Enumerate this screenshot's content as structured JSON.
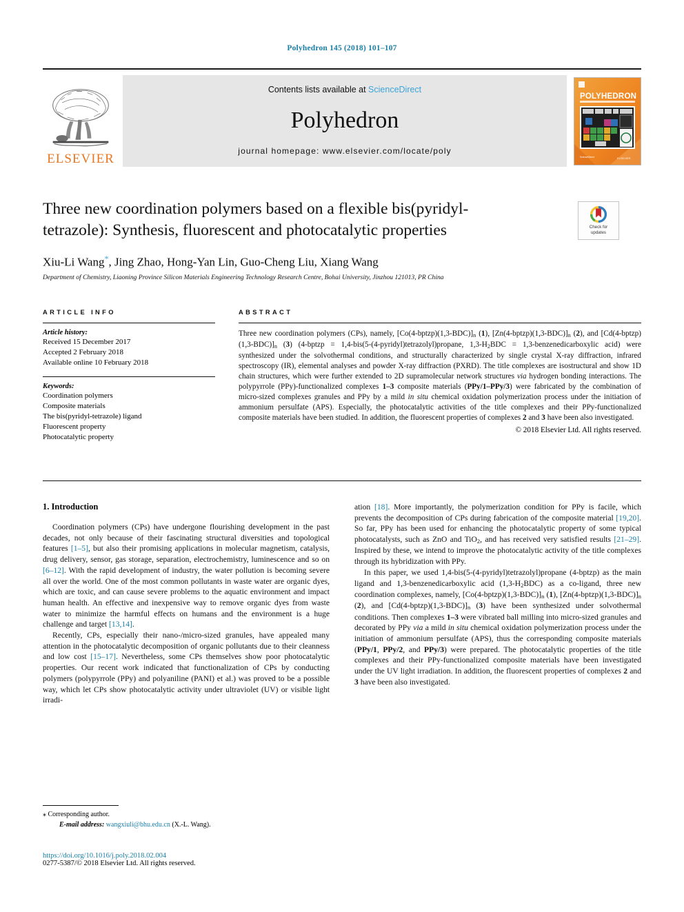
{
  "running_head": "Polyhedron 145 (2018) 101–107",
  "masthead": {
    "publisher_name": "ELSEVIER",
    "contents_prefix": "Contents lists available at ",
    "contents_link": "ScienceDirect",
    "journal_name": "Polyhedron",
    "homepage": "journal homepage: www.elsevier.com/locate/poly",
    "cover_title": "POLYHEDRON",
    "cover_subtitle": "THE INTERNATIONAL JOURNAL FOR INORGANIC AND ORGANOMETALLIC CHEMISTRY",
    "cover_publisher": "ELSEVIER"
  },
  "title": {
    "line1": "Three new coordination polymers based on a flexible bis(pyridyl-",
    "line2": "tetrazole): Synthesis, fluorescent and photocatalytic properties",
    "authors": "Xiu-Li Wang *, Jing Zhao, Hong-Yan Lin, Guo-Cheng Liu, Xiang Wang",
    "affiliation": "Department of Chemistry, Liaoning Province Silicon Materials Engineering Technology Research Centre, Bohai University, Jinzhou 121013, PR China"
  },
  "crossmark": {
    "line1": "Check for",
    "line2": "updates"
  },
  "article_info": {
    "heading": "ARTICLE INFO",
    "history_label": "Article history:",
    "history": [
      "Received 15 December 2017",
      "Accepted 2 February 2018",
      "Available online 10 February 2018"
    ],
    "keywords_label": "Keywords:",
    "keywords": [
      "Coordination polymers",
      "Composite materials",
      "The bis(pyridyl-tetrazole) ligand",
      "Fluorescent property",
      "Photocatalytic property"
    ]
  },
  "abstract": {
    "heading": "ABSTRACT",
    "text": "Three new coordination polymers (CPs), namely, [Co(4-bptzp)(1,3-BDC)]n (1), [Zn(4-bptzp)(1,3-BDC)]n (2), and [Cd(4-bptzp)(1,3-BDC)]n (3) (4-bptzp = 1,4-bis(5-(4-pyridyl)tetrazolyl)propane, 1,3-H2BDC = 1,3-benzenedicarboxylic acid) were synthesized under the solvothermal conditions, and structurally characterized by single crystal X-ray diffraction, infrared spectroscopy (IR), elemental analyses and powder X-ray diffraction (PXRD). The title complexes are isostructural and show 1D chain structures, which were further extended to 2D supramolecular network structures via hydrogen bonding interactions. The polypyrrole (PPy)-functionalized complexes 1–3 composite materials (PPy/1–PPy/3) were fabricated by the combination of micro-sized complexes granules and PPy by a mild in situ chemical oxidation polymerization process under the initiation of ammonium persulfate (APS). Especially, the photocatalytic activities of the title complexes and their PPy-functionalized composite materials have been studied. In addition, the fluorescent properties of complexes 2 and 3 have been also investigated.",
    "copyright": "© 2018 Elsevier Ltd. All rights reserved."
  },
  "introduction": {
    "heading": "1. Introduction",
    "left_p1": "Coordination polymers (CPs) have undergone flourishing development in the past decades, not only because of their fascinating structural diversities and topological features [1–5], but also their promising applications in molecular magnetism, catalysis, drug delivery, sensor, gas storage, separation, electrochemistry, luminescence and so on [6–12]. With the rapid development of industry, the water pollution is becoming severe all over the world. One of the most common pollutants in waste water are organic dyes, which are toxic, and can cause severe problems to the aquatic environment and impact human health. An effective and inexpensive way to remove organic dyes from waste water to minimize the harmful effects on humans and the environment is a huge challenge and target [13,14].",
    "left_p2": "Recently, CPs, especially their nano-/micro-sized granules, have appealed many attention in the photocatalytic decomposition of organic pollutants due to their cleanness and low cost [15–17]. Nevertheless, some CPs themselves show poor photocatalytic properties. Our recent work indicated that functionalization of CPs by conducting polymers (polypyrrole (PPy) and polyaniline (PANI) et al.) was proved to be a possible way, which let CPs show photocatalytic activity under ultraviolet (UV) or visible light irradi-",
    "right_p1": "ation [18]. More importantly, the polymerization condition for PPy is facile, which prevents the decomposition of CPs during fabrication of the composite material [19,20]. So far, PPy has been used for enhancing the photocatalytic property of some typical photocatalysts, such as ZnO and TiO2, and has received very satisfied results [21–29]. Inspired by these, we intend to improve the photocatalytic activity of the title complexes through its hybridization with PPy.",
    "right_p2": "In this paper, we used 1,4-bis(5-(4-pyridyl)tetrazolyl)propane (4-bptzp) as the main ligand and 1,3-benzenedicarboxylic acid (1,3-H2BDC) as a co-ligand, three new coordination complexes, namely, [Co(4-bptzp)(1,3-BDC)]n (1), [Zn(4-bptzp)(1,3-BDC)]n (2), and [Cd(4-bptzp)(1,3-BDC)]n (3) have been synthesized under solvothermal conditions. Then complexes 1–3 were vibrated ball milling into micro-sized granules and decorated by PPy via a mild in situ chemical oxidation polymerization process under the initiation of ammonium persulfate (APS), thus the corresponding composite materials (PPy/1, PPy/2, and PPy/3) were prepared. The photocatalytic properties of the title complexes and their PPy-functionalized composite materials have been investigated under the UV light irradiation. In addition, the fluorescent properties of complexes 2 and 3 have been also investigated."
  },
  "footer": {
    "corresponding_marker": "⁎",
    "corresponding_text": "Corresponding author.",
    "email_label": "E-mail address:",
    "email": "wangxiuli@bhu.edu.cn",
    "email_suffix": "(X.-L. Wang).",
    "doi": "https://doi.org/10.1016/j.poly.2018.02.004",
    "issn": "0277-5387/© 2018 Elsevier Ltd. All rights reserved."
  },
  "colors": {
    "link": "#1a7fa8",
    "sciencedirect": "#3ca4d8",
    "elsevier_orange": "#e87722",
    "band_gray": "#e6e6e6"
  }
}
